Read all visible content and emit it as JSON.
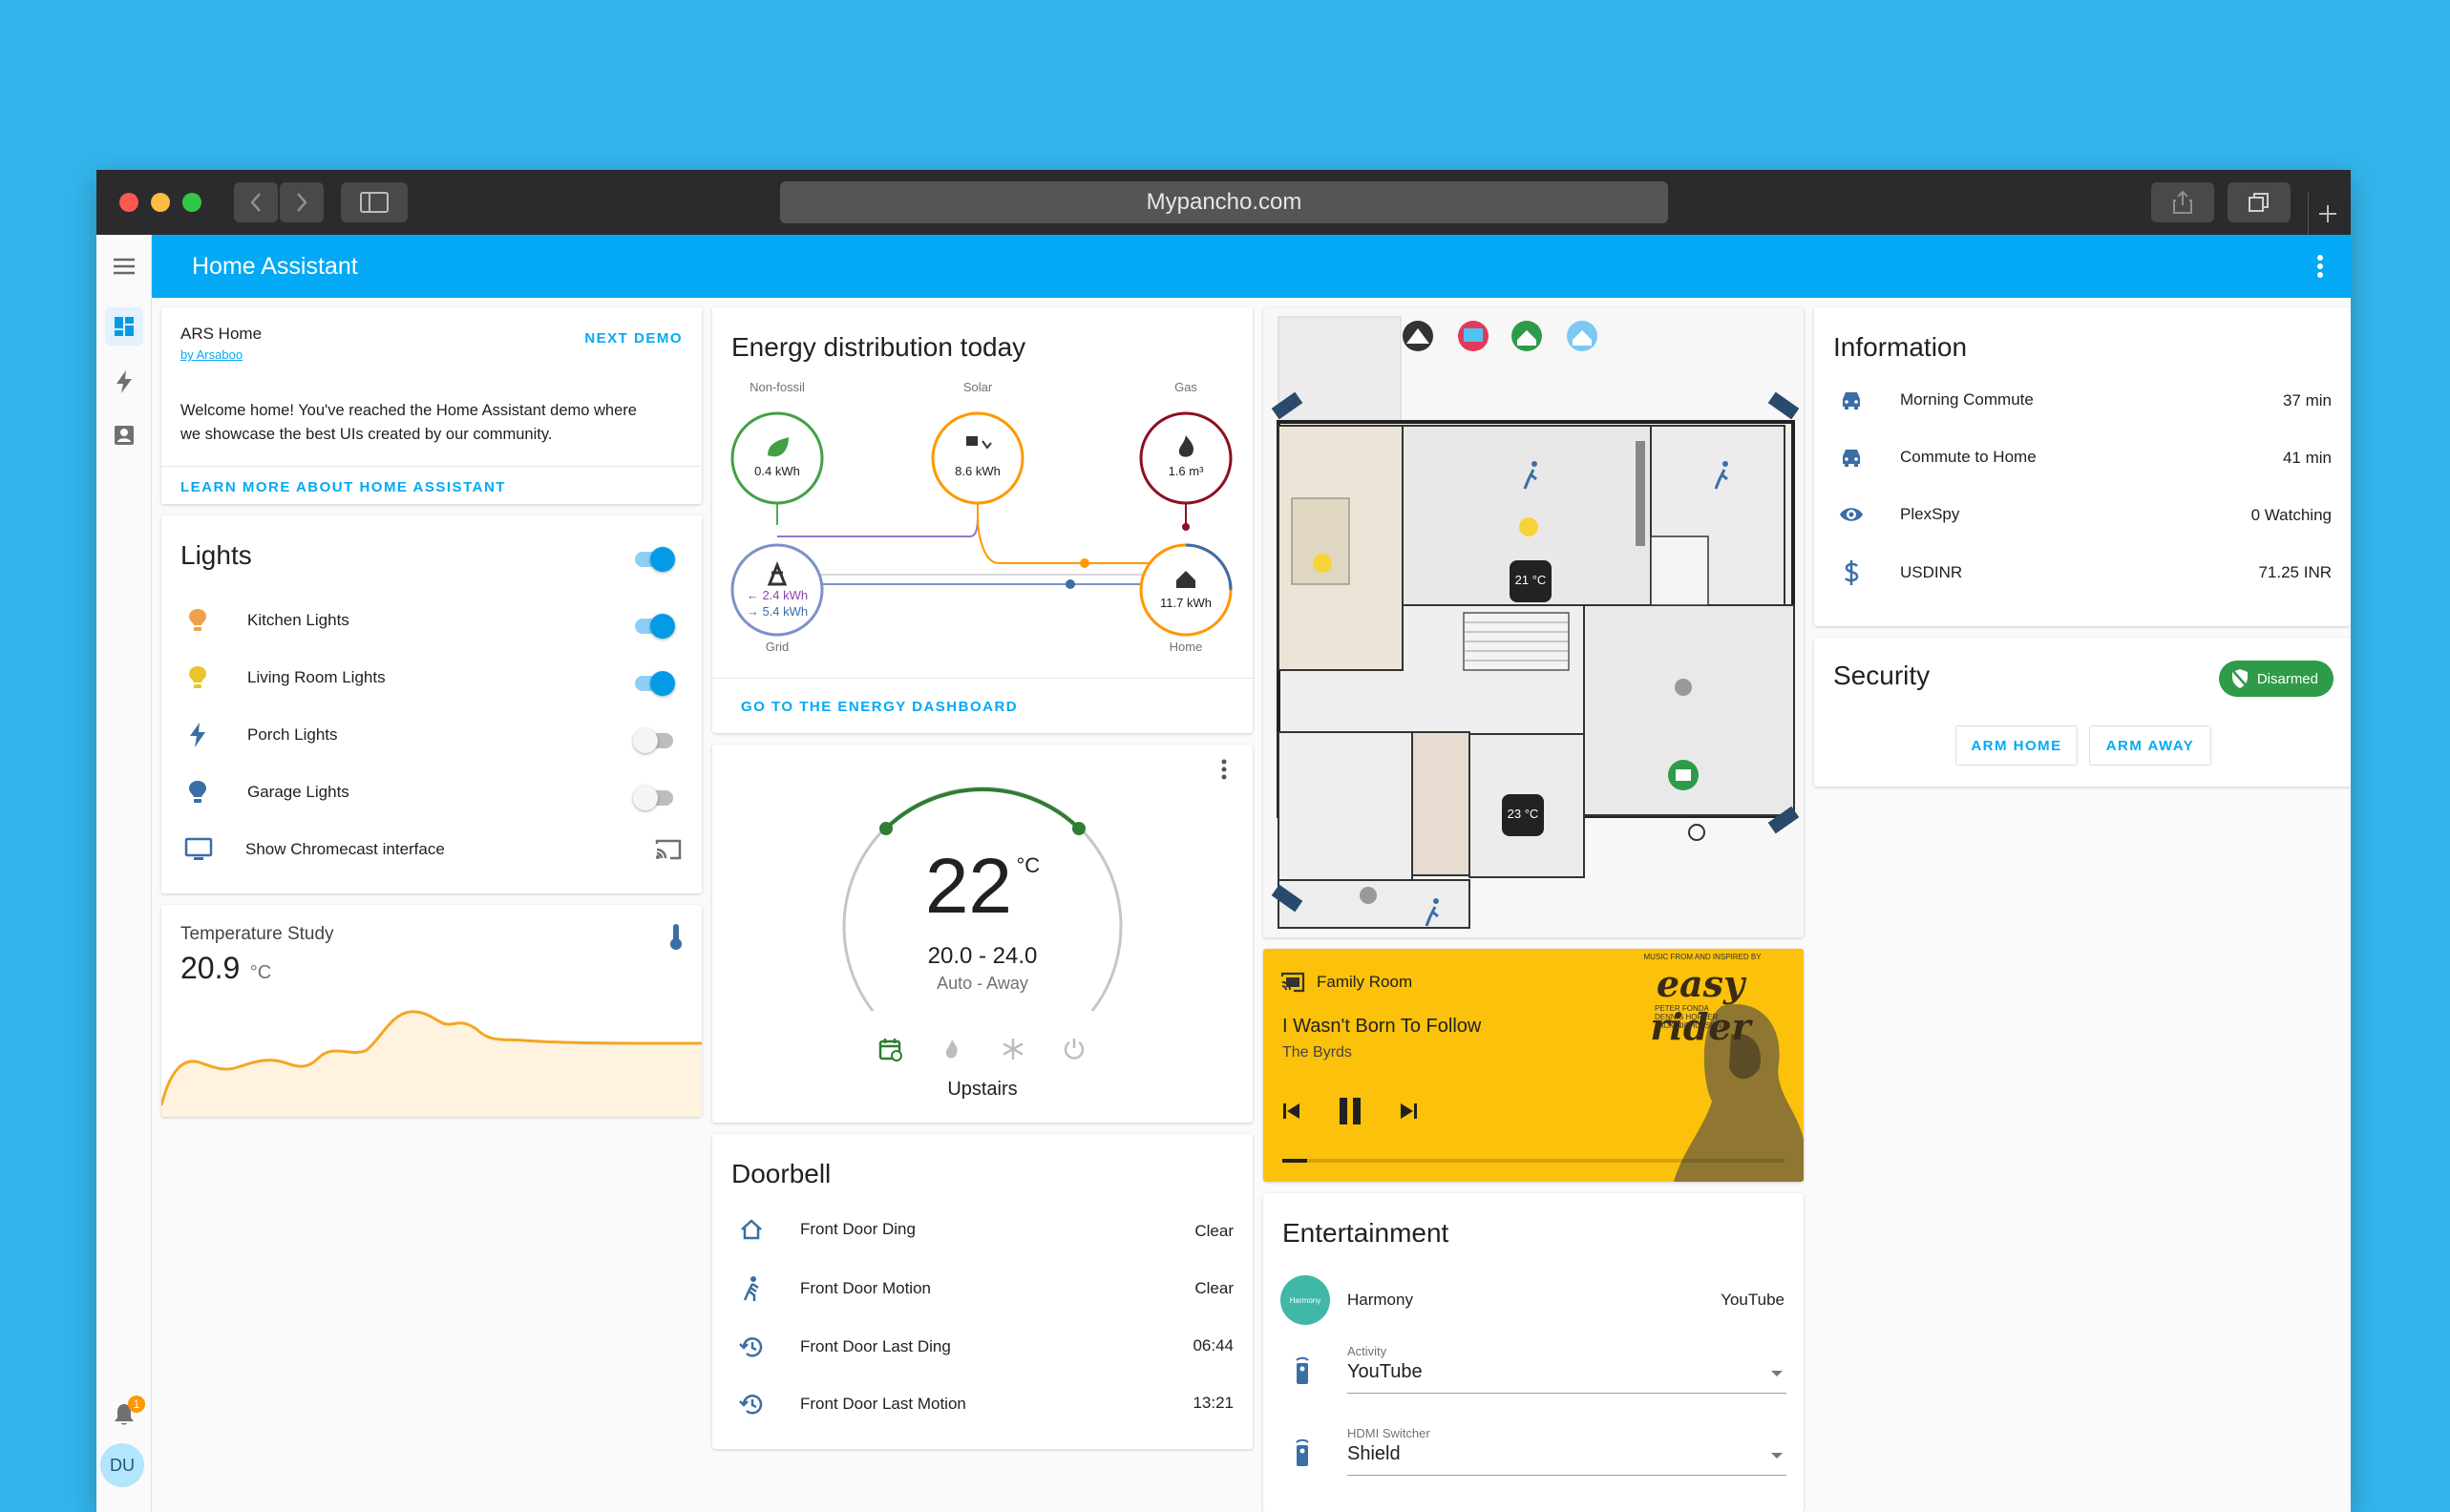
{
  "browser": {
    "url": "Mypancho.com"
  },
  "app": {
    "title": "Home Assistant",
    "user_initials": "DU",
    "notification_count": "1"
  },
  "welcome": {
    "title": "ARS Home",
    "byline": "by Arsaboo",
    "next_demo": "NEXT DEMO",
    "body_line1": "Welcome home! You've reached the Home Assistant demo where",
    "body_line2": "we showcase the best UIs created by our community.",
    "learn_more": "LEARN MORE ABOUT HOME ASSISTANT"
  },
  "lights": {
    "title": "Lights",
    "master_on": true,
    "items": [
      {
        "label": "Kitchen Lights",
        "icon": "bulb-icon",
        "color": "#f0a04b",
        "on": true
      },
      {
        "label": "Living Room Lights",
        "icon": "bulb-icon",
        "color": "#e8c52a",
        "on": true
      },
      {
        "label": "Porch Lights",
        "icon": "flash-icon",
        "color": "#3a6ea5",
        "on": false
      },
      {
        "label": "Garage Lights",
        "icon": "bulb-icon",
        "color": "#3a6ea5",
        "on": false
      }
    ],
    "chromecast_label": "Show Chromecast interface"
  },
  "temperature": {
    "title": "Temperature Study",
    "value": "20.9",
    "unit": "°C"
  },
  "energy": {
    "title": "Energy distribution today",
    "nodes": {
      "non_fossil": {
        "label": "Non-fossil",
        "value": "0.4 kWh"
      },
      "solar": {
        "label": "Solar",
        "value": "8.6 kWh"
      },
      "gas": {
        "label": "Gas",
        "value": "1.6 m³"
      },
      "grid": {
        "label": "Grid",
        "in": "← 2.4 kWh",
        "out": "→ 5.4 kWh"
      },
      "home": {
        "label": "Home",
        "value": "11.7 kWh"
      }
    },
    "link": "GO TO THE ENERGY DASHBOARD"
  },
  "thermostat": {
    "temp": "22",
    "unit": "°C",
    "range": "20.0 - 24.0",
    "mode": "Auto - Away",
    "name": "Upstairs"
  },
  "doorbell": {
    "title": "Doorbell",
    "rows": [
      {
        "label": "Front Door Ding",
        "value": "Clear"
      },
      {
        "label": "Front Door Motion",
        "value": "Clear"
      },
      {
        "label": "Front Door Last Ding",
        "value": "06:44"
      },
      {
        "label": "Front Door Last Motion",
        "value": "13:21"
      }
    ]
  },
  "floorplan": {
    "thermo_1": "21 °C",
    "thermo_2": "23 °C"
  },
  "media": {
    "room": "Family Room",
    "song": "I Wasn't Born To Follow",
    "artist": "The Byrds",
    "cover_text": "easy rider",
    "cover_top": "MUSIC FROM AND INSPIRED BY",
    "cover_cast_1": "PETER FONDA",
    "cover_cast_2": "DENNIS HOPPER",
    "cover_cast_3": "JACK NICHOLSON",
    "progress": 0.05
  },
  "entertainment": {
    "title": "Entertainment",
    "harmony_label": "Harmony",
    "harmony_value": "YouTube",
    "activity_label": "Activity",
    "activity_value": "YouTube",
    "hdmi_label": "HDMI Switcher",
    "hdmi_value": "Shield"
  },
  "information": {
    "title": "Information",
    "rows": [
      {
        "icon": "car-icon",
        "label": "Morning Commute",
        "value": "37 min"
      },
      {
        "icon": "car-icon",
        "label": "Commute to Home",
        "value": "41 min"
      },
      {
        "icon": "eye-icon",
        "label": "PlexSpy",
        "value": "0 Watching"
      },
      {
        "icon": "dollar-icon",
        "label": "USDINR",
        "value": "71.25 INR"
      }
    ]
  },
  "security": {
    "title": "Security",
    "state": "Disarmed",
    "arm_home": "ARM HOME",
    "arm_away": "ARM AWAY"
  },
  "colors": {
    "background": "#33b5ec",
    "primary": "#03a9f4",
    "green": "#43a047",
    "orange": "#ff9800",
    "gas": "#8e0f22",
    "media_bg": "#fcc10a"
  }
}
